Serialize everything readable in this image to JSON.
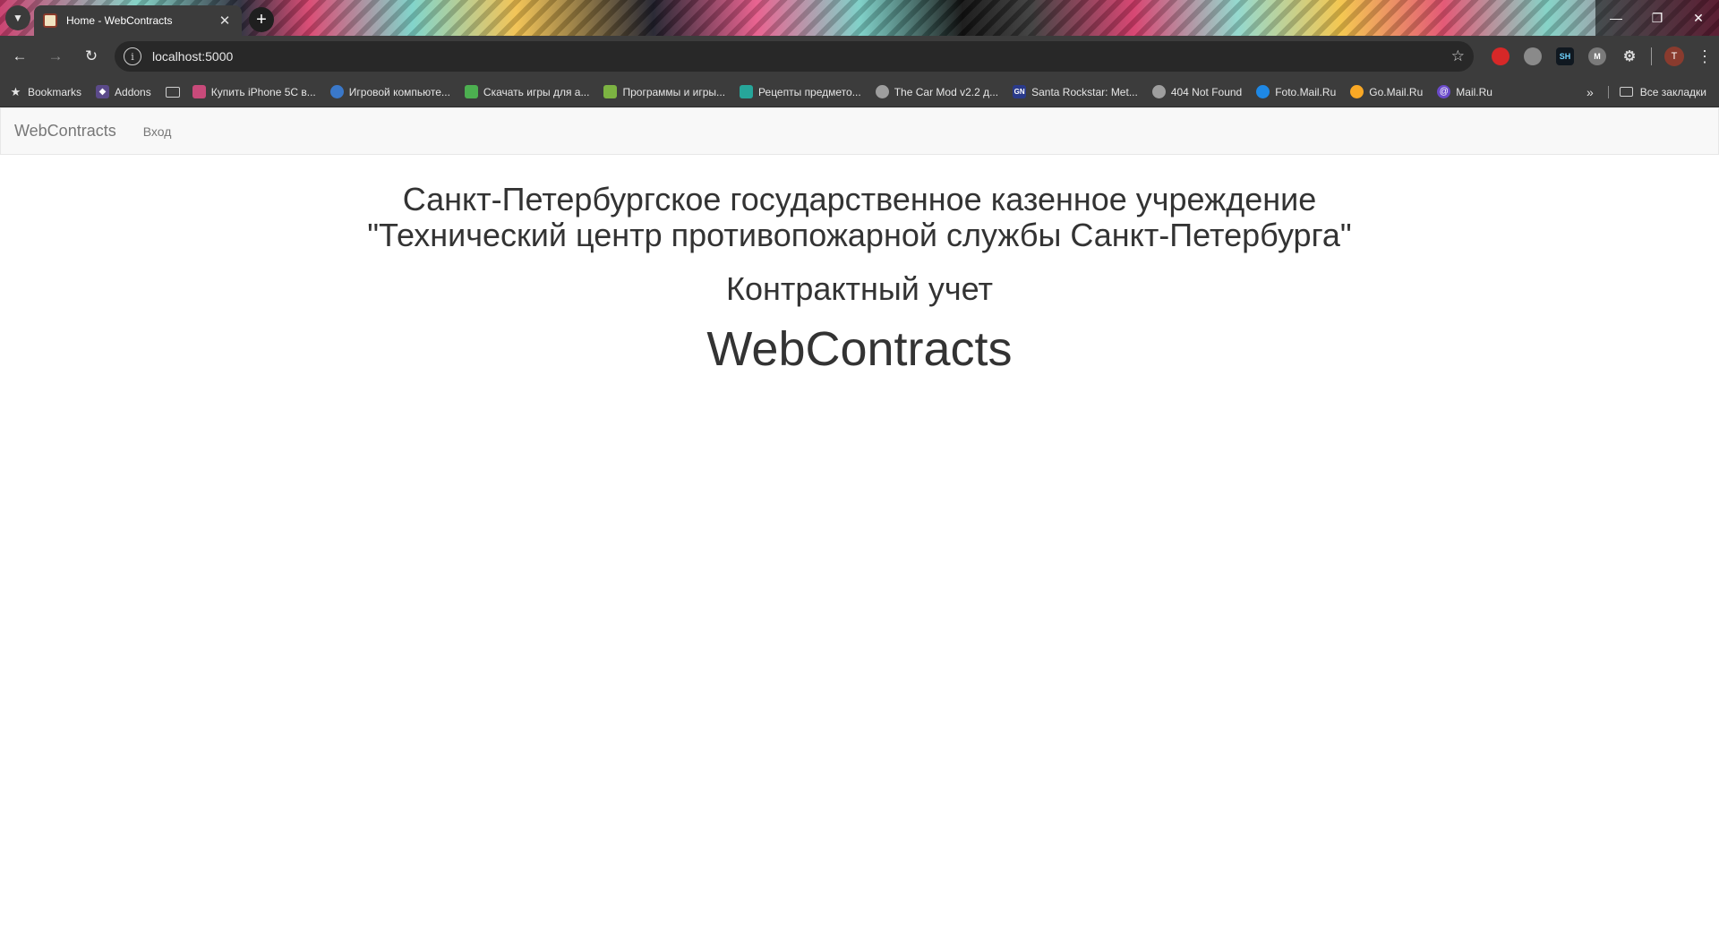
{
  "browser": {
    "tab_title": "Home - WebContracts",
    "url": "localhost:5000",
    "profile_initial": "T",
    "extensions": [
      "SH",
      "M"
    ],
    "bookmarks": [
      {
        "label": "Bookmarks",
        "icon": "star-icon",
        "color": "#2b2b2b"
      },
      {
        "label": "Addons",
        "icon": "addons-icon",
        "color": "#5b4a8a"
      },
      {
        "label": "Купить iPhone 5C в...",
        "icon": "shop-icon",
        "color": "#c84a7a"
      },
      {
        "label": "Игровой компьюте...",
        "icon": "shield-icon",
        "color": "#3a78c9"
      },
      {
        "label": "Скачать игры для а...",
        "icon": "game-icon",
        "color": "#4caf50"
      },
      {
        "label": "Программы и игры...",
        "icon": "android-icon",
        "color": "#7cb342"
      },
      {
        "label": "Рецепты предмето...",
        "icon": "recipe-icon",
        "color": "#26a69a"
      },
      {
        "label": "The Car Mod v2.2 д...",
        "icon": "globe-icon",
        "color": "#9e9e9e"
      },
      {
        "label": "Santa Rockstar: Met...",
        "icon": "gn-icon",
        "color": "#2a3a8a"
      },
      {
        "label": "404 Not Found",
        "icon": "globe-icon",
        "color": "#9e9e9e"
      },
      {
        "label": "Foto.Mail.Ru",
        "icon": "foto-icon",
        "color": "#1e88e5"
      },
      {
        "label": "Go.Mail.Ru",
        "icon": "go-icon",
        "color": "#f9a825"
      },
      {
        "label": "Mail.Ru",
        "icon": "mail-icon",
        "color": "#6a4ac9"
      }
    ],
    "all_bookmarks_label": "Все закладки"
  },
  "site": {
    "brand": "WebContracts",
    "login_link": "Вход",
    "org_line1": "Санкт-Петербургское государственное казенное учреждение",
    "org_line2": "\"Технический центр противопожарной службы Санкт-Петербурга\"",
    "subtitle": "Контрактный учет",
    "app_name": "WebContracts"
  }
}
